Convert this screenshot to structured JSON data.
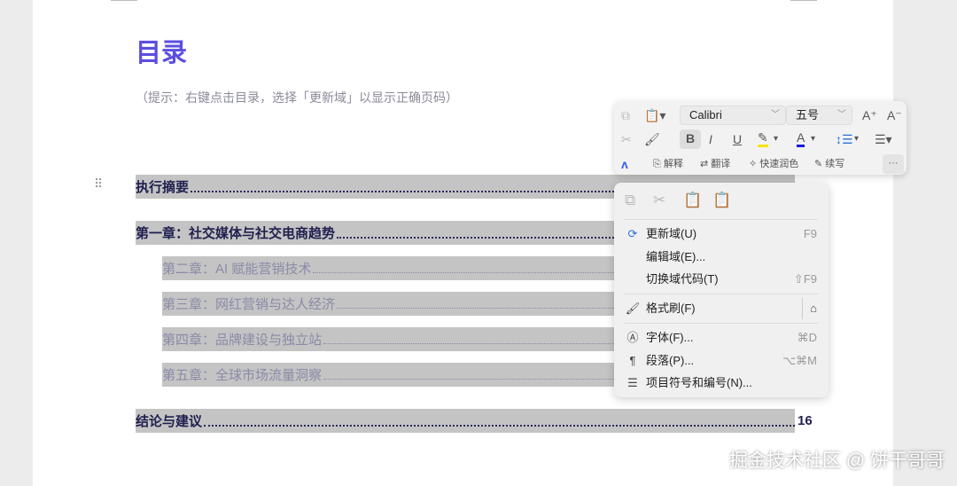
{
  "doc": {
    "title": "目录",
    "hint": "（提示：右键点击目录，选择「更新域」以显示正确页码）",
    "toc": [
      {
        "text": "执行摘要",
        "level": 1,
        "page": ""
      },
      {
        "text": "第一章：社交媒体与社交电商趋势",
        "level": 1,
        "page": ""
      },
      {
        "text": "第二章：AI 赋能营销技术",
        "level": 2,
        "page": ""
      },
      {
        "text": "第三章：网红营销与达人经济",
        "level": 2,
        "page": ""
      },
      {
        "text": "第四章：品牌建设与独立站",
        "level": 2,
        "page": ""
      },
      {
        "text": "第五章：全球市场流量洞察",
        "level": 2,
        "page": ""
      },
      {
        "text": "结论与建议",
        "level": 1,
        "page": "16"
      }
    ]
  },
  "toolbar": {
    "font": "Calibri",
    "size": "五号",
    "explain": "解释",
    "translate": "翻译",
    "polish": "快速润色",
    "continue": "续写",
    "more": "···",
    "highlight_color": "#f5e600",
    "font_color": "#1a1adf"
  },
  "menu": {
    "items": [
      {
        "label": "更新域(U)",
        "shortcut": "F9"
      },
      {
        "label": "编辑域(E)...",
        "shortcut": ""
      },
      {
        "label": "切换域代码(T)",
        "shortcut": "⇧F9"
      },
      {
        "label": "格式刷(F)",
        "shortcut": ""
      },
      {
        "label": "字体(F)...",
        "shortcut": "⌘D"
      },
      {
        "label": "段落(P)...",
        "shortcut": "⌥⌘M"
      },
      {
        "label": "项目符号和编号(N)...",
        "shortcut": ""
      }
    ]
  },
  "watermark": "掘金技术社区 @ 饼干哥哥"
}
